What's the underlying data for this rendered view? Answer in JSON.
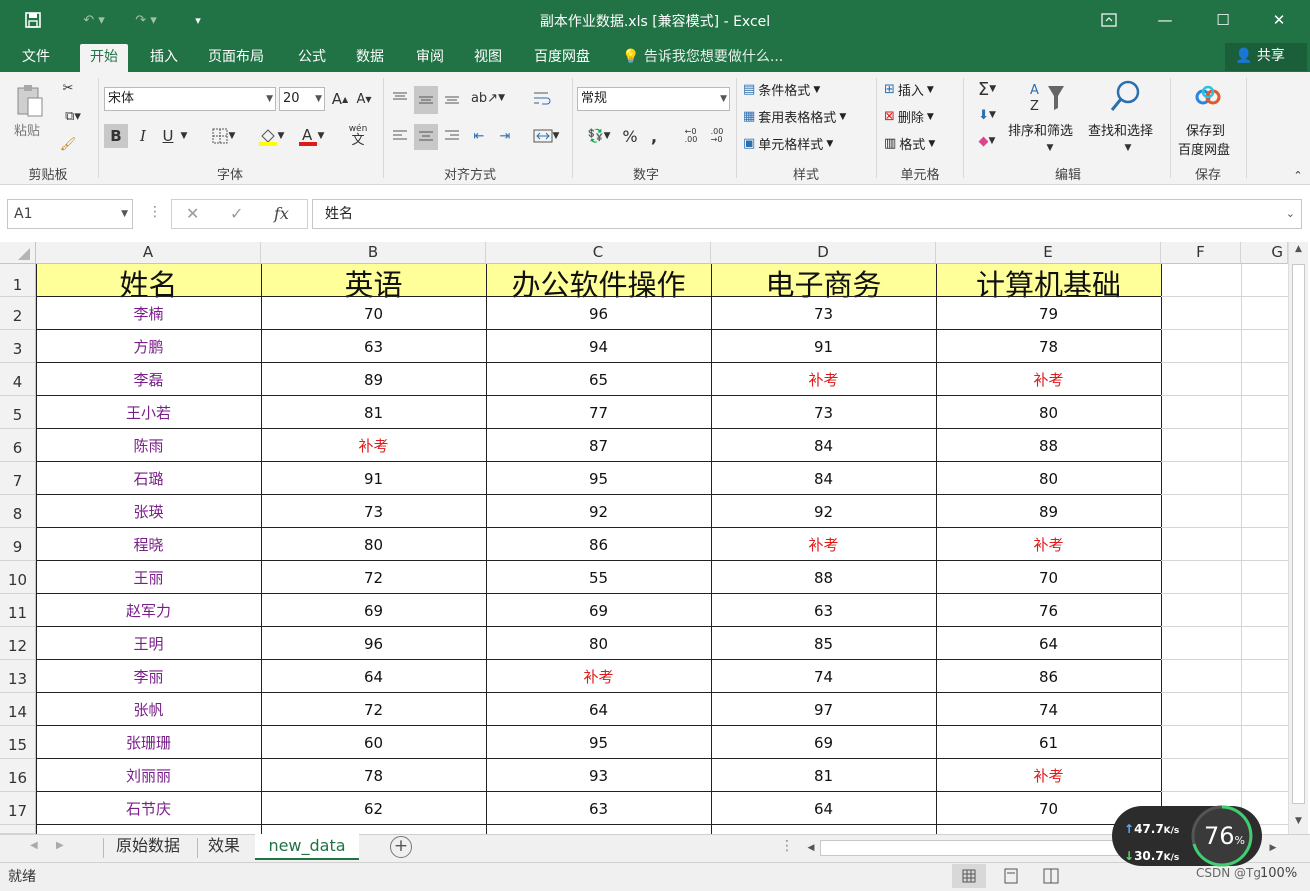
{
  "window": {
    "title": "副本作业数据.xls  [兼容模式] - Excel"
  },
  "menu_tabs": [
    "文件",
    "开始",
    "插入",
    "页面布局",
    "公式",
    "数据",
    "审阅",
    "视图",
    "百度网盘"
  ],
  "tell_me": "告诉我您想要做什么...",
  "share": "共享",
  "ribbon": {
    "clipboard": {
      "paste": "粘贴",
      "label": "剪贴板"
    },
    "font": {
      "name": "宋体",
      "size": "20",
      "label": "字体",
      "bold": "B",
      "italic": "I",
      "underline": "U",
      "grow": "A",
      "shrink": "A",
      "wen": "wén",
      "wen_char": "文"
    },
    "alignment": {
      "label": "对齐方式"
    },
    "number": {
      "format": "常规",
      "label": "数字",
      "percent": "%",
      "comma": ","
    },
    "styles": {
      "cond": "条件格式",
      "table": "套用表格格式",
      "cell": "单元格样式",
      "label": "样式"
    },
    "cells": {
      "insert": "插入",
      "delete": "删除",
      "format": "格式",
      "label": "单元格"
    },
    "editing": {
      "sort": "排序和筛选",
      "find": "查找和选择",
      "label": "编辑",
      "sigma": "Σ"
    },
    "save": {
      "line1": "保存到",
      "line2": "百度网盘",
      "label": "保存"
    }
  },
  "formula_bar": {
    "name_box": "A1",
    "fx": "fx",
    "content": "姓名"
  },
  "columns": [
    "A",
    "B",
    "C",
    "D",
    "E",
    "F",
    "G"
  ],
  "headers": [
    "姓名",
    "英语",
    "办公软件操作",
    "电子商务",
    "计算机基础"
  ],
  "rows": [
    [
      "李楠",
      "70",
      "96",
      "73",
      "79"
    ],
    [
      "方鹏",
      "63",
      "94",
      "91",
      "78"
    ],
    [
      "李磊",
      "89",
      "65",
      "补考",
      "补考"
    ],
    [
      "王小若",
      "81",
      "77",
      "73",
      "80"
    ],
    [
      "陈雨",
      "补考",
      "87",
      "84",
      "88"
    ],
    [
      "石璐",
      "91",
      "95",
      "84",
      "80"
    ],
    [
      "张瑛",
      "73",
      "92",
      "92",
      "89"
    ],
    [
      "程晓",
      "80",
      "86",
      "补考",
      "补考"
    ],
    [
      "王丽",
      "72",
      "55",
      "88",
      "70"
    ],
    [
      "赵军力",
      "69",
      "69",
      "63",
      "76"
    ],
    [
      "王明",
      "96",
      "80",
      "85",
      "64"
    ],
    [
      "李丽",
      "64",
      "补考",
      "74",
      "86"
    ],
    [
      "张帆",
      "72",
      "64",
      "97",
      "74"
    ],
    [
      "张珊珊",
      "60",
      "95",
      "69",
      "61"
    ],
    [
      "刘丽丽",
      "78",
      "93",
      "81",
      "补考"
    ],
    [
      "石节庆",
      "62",
      "63",
      "64",
      "70"
    ]
  ],
  "sheet_tabs": [
    "原始数据",
    "效果",
    "new_data"
  ],
  "active_sheet": "new_data",
  "status": {
    "ready": "就绪",
    "zoom": "100%",
    "credit": "CSDN @Tg"
  },
  "net_widget": {
    "up": "47.7",
    "down": "30.7",
    "unit": "K/s",
    "percent": "76",
    "pct_sign": "%"
  }
}
